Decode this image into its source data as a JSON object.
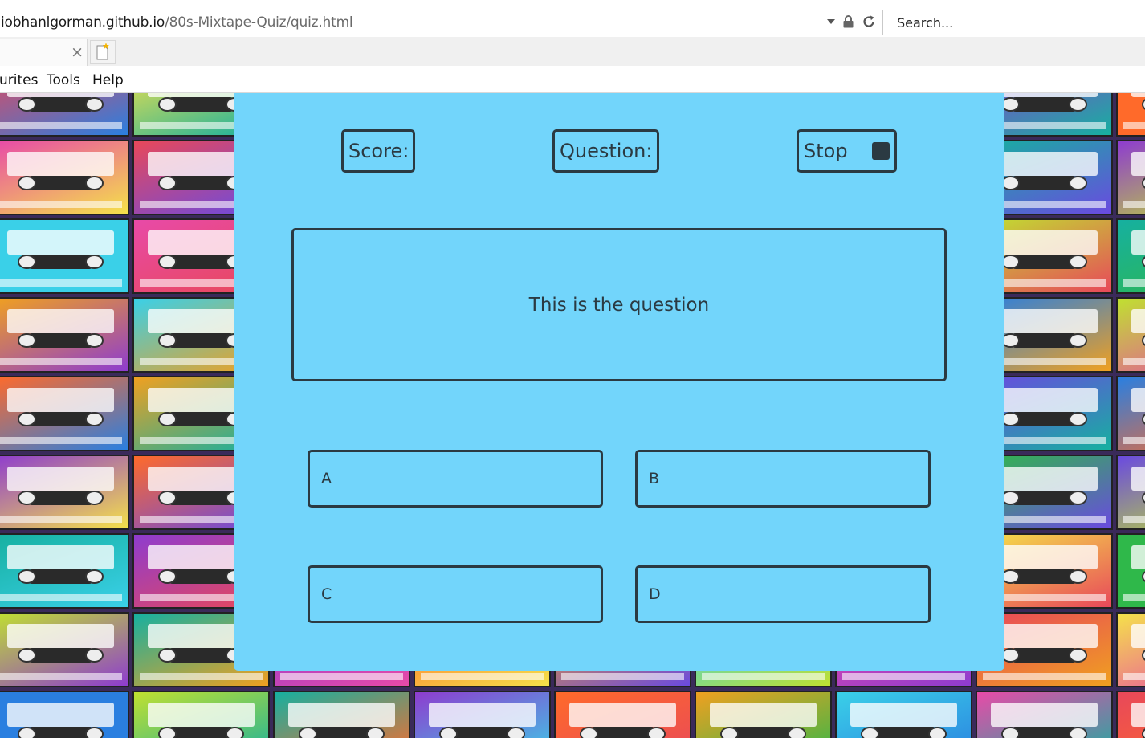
{
  "browser": {
    "url_host": "iobhanlgorman.github.io",
    "url_path": "/80s-Mixtape-Quiz/quiz.html",
    "search_placeholder": "Search...",
    "tab_close": "×",
    "menu": [
      "urites",
      "Tools",
      "Help"
    ]
  },
  "quiz": {
    "score_label": "Score:",
    "question_label": "Question:",
    "stop_label": "Stop",
    "question_text": "This is the question",
    "answers": [
      "A",
      "B",
      "C",
      "D"
    ]
  },
  "colors": {
    "panel": "#72d5fb",
    "border": "#2b3a42",
    "text": "#2b3a42"
  },
  "icons": [
    "dropdown-arrow-icon",
    "lock-icon",
    "refresh-icon",
    "close-icon",
    "new-tab-icon",
    "stop-square-icon"
  ]
}
